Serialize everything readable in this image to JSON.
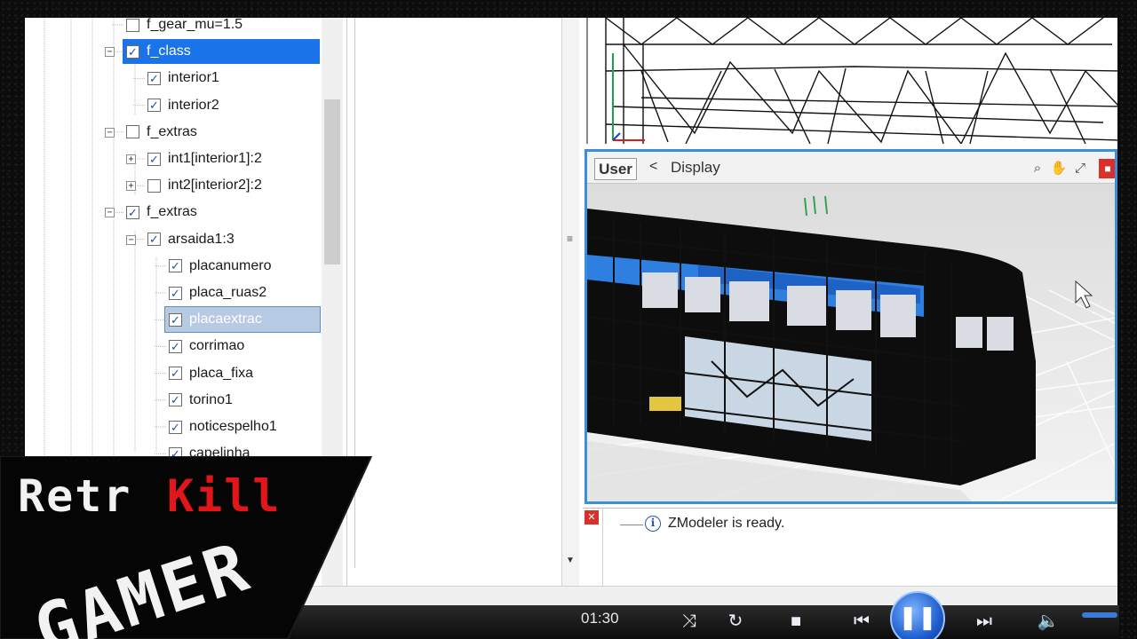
{
  "tree": {
    "items": [
      {
        "label": "f_gear_mu=1.5",
        "checked": false,
        "depth": 0,
        "expander": "",
        "selected": ""
      },
      {
        "label": "f_class",
        "checked": true,
        "depth": 0,
        "expander": "−",
        "selected": "blue"
      },
      {
        "label": "interior1",
        "checked": true,
        "depth": 1,
        "expander": "",
        "selected": ""
      },
      {
        "label": "interior2",
        "checked": true,
        "depth": 1,
        "expander": "",
        "selected": ""
      },
      {
        "label": "f_extras",
        "checked": false,
        "depth": 0,
        "expander": "−",
        "selected": ""
      },
      {
        "label": "int1[interior1]:2",
        "checked": true,
        "depth": 1,
        "expander": "+",
        "selected": ""
      },
      {
        "label": "int2[interior2]:2",
        "checked": false,
        "depth": 1,
        "expander": "+",
        "selected": ""
      },
      {
        "label": "f_extras",
        "checked": true,
        "depth": 0,
        "expander": "−",
        "selected": ""
      },
      {
        "label": "arsaida1:3",
        "checked": true,
        "depth": 1,
        "expander": "−",
        "selected": ""
      },
      {
        "label": "placanumero",
        "checked": true,
        "depth": 2,
        "expander": "",
        "selected": ""
      },
      {
        "label": "placa_ruas2",
        "checked": true,
        "depth": 2,
        "expander": "",
        "selected": ""
      },
      {
        "label": "placaextrac",
        "checked": true,
        "depth": 2,
        "expander": "",
        "selected": "gray"
      },
      {
        "label": "corrimao",
        "checked": true,
        "depth": 2,
        "expander": "",
        "selected": ""
      },
      {
        "label": "placa_fixa",
        "checked": true,
        "depth": 2,
        "expander": "",
        "selected": ""
      },
      {
        "label": "torino1",
        "checked": true,
        "depth": 2,
        "expander": "",
        "selected": ""
      },
      {
        "label": "noticespelho1",
        "checked": true,
        "depth": 2,
        "expander": "",
        "selected": ""
      },
      {
        "label": "capelinha",
        "checked": true,
        "depth": 2,
        "expander": "",
        "selected": ""
      }
    ]
  },
  "viewport": {
    "user_label": "User",
    "back_glyph": "<",
    "title": "Display",
    "tools": [
      "zoom-icon",
      "pan-icon",
      "fit-icon"
    ]
  },
  "log": {
    "message": "ZModeler is ready."
  },
  "player": {
    "time": "01:30"
  },
  "watermark": {
    "line1_white": "Retr",
    "line1_red": "Kill",
    "line2": "GAMER"
  },
  "colors": {
    "selection_blue": "#1a73e8",
    "viewport_border": "#3b8fd9",
    "watermark_red": "#e0161b",
    "check_blue": "#1e4fb0"
  }
}
